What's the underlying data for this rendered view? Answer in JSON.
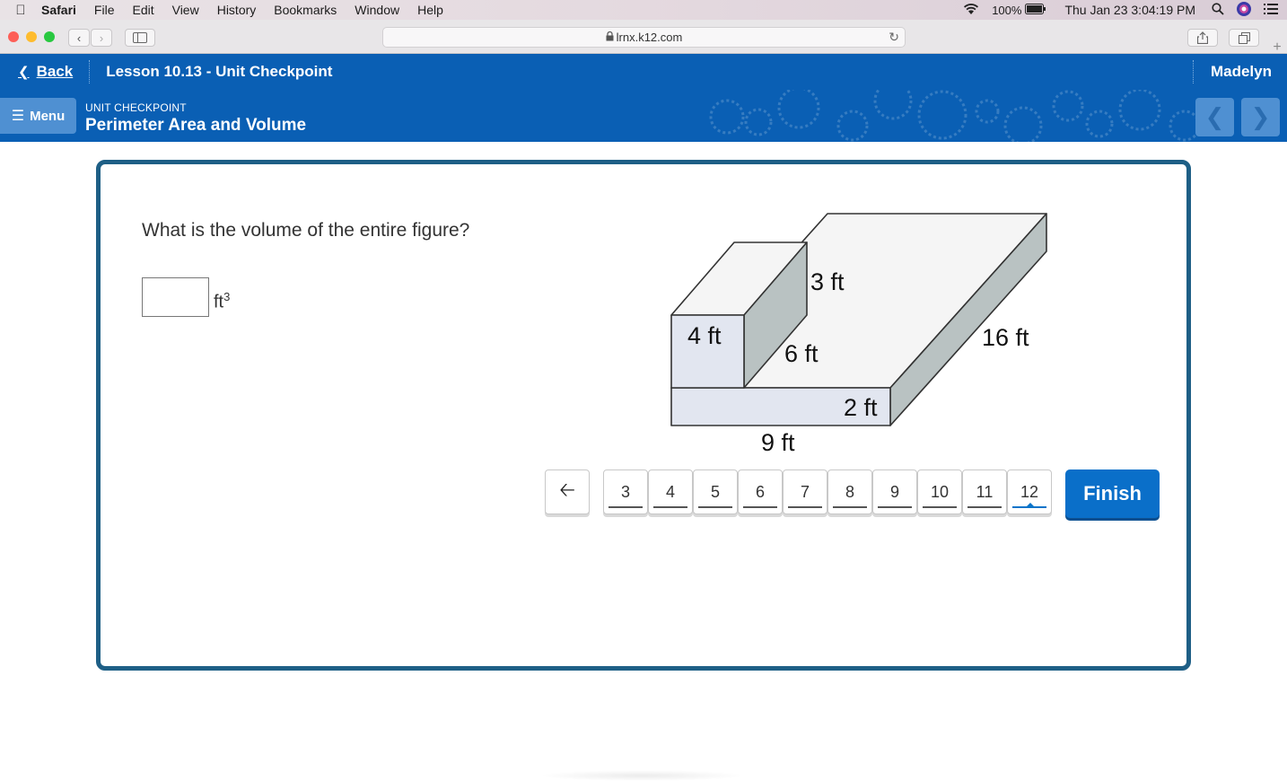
{
  "menubar": {
    "app": "Safari",
    "items": [
      "File",
      "Edit",
      "View",
      "History",
      "Bookmarks",
      "Window",
      "Help"
    ],
    "battery": "100%",
    "datetime": "Thu Jan 23  3:04:19 PM"
  },
  "browser": {
    "url": "lrnx.k12.com"
  },
  "header": {
    "back_label": "Back",
    "lesson_title": "Lesson 10.13 - Unit Checkpoint",
    "user_name": "Madelyn",
    "menu_label": "Menu",
    "kicker": "UNIT CHECKPOINT",
    "unit_title": "Perimeter Area and Volume"
  },
  "question": {
    "prompt": "What is the volume of the entire figure?",
    "answer_value": "",
    "unit": "ft",
    "unit_exp": "3"
  },
  "figure": {
    "labels": {
      "top_height": "3 ft",
      "front_height": "4 ft",
      "small_depth": "6 ft",
      "long_depth": "16 ft",
      "base_height": "2 ft",
      "base_width": "9 ft"
    },
    "colors": {
      "top": "#f5f5f5",
      "front": "#e2e6f0",
      "side": "#b9c2c2",
      "stroke": "#333333"
    }
  },
  "pager": {
    "pages": [
      "3",
      "4",
      "5",
      "6",
      "7",
      "8",
      "9",
      "10",
      "11",
      "12"
    ],
    "current": "12",
    "finish_label": "Finish"
  },
  "colors": {
    "brand_blue": "#0a5fb4",
    "card_border": "#1e5f86",
    "finish_blue": "#0a6fc9"
  }
}
